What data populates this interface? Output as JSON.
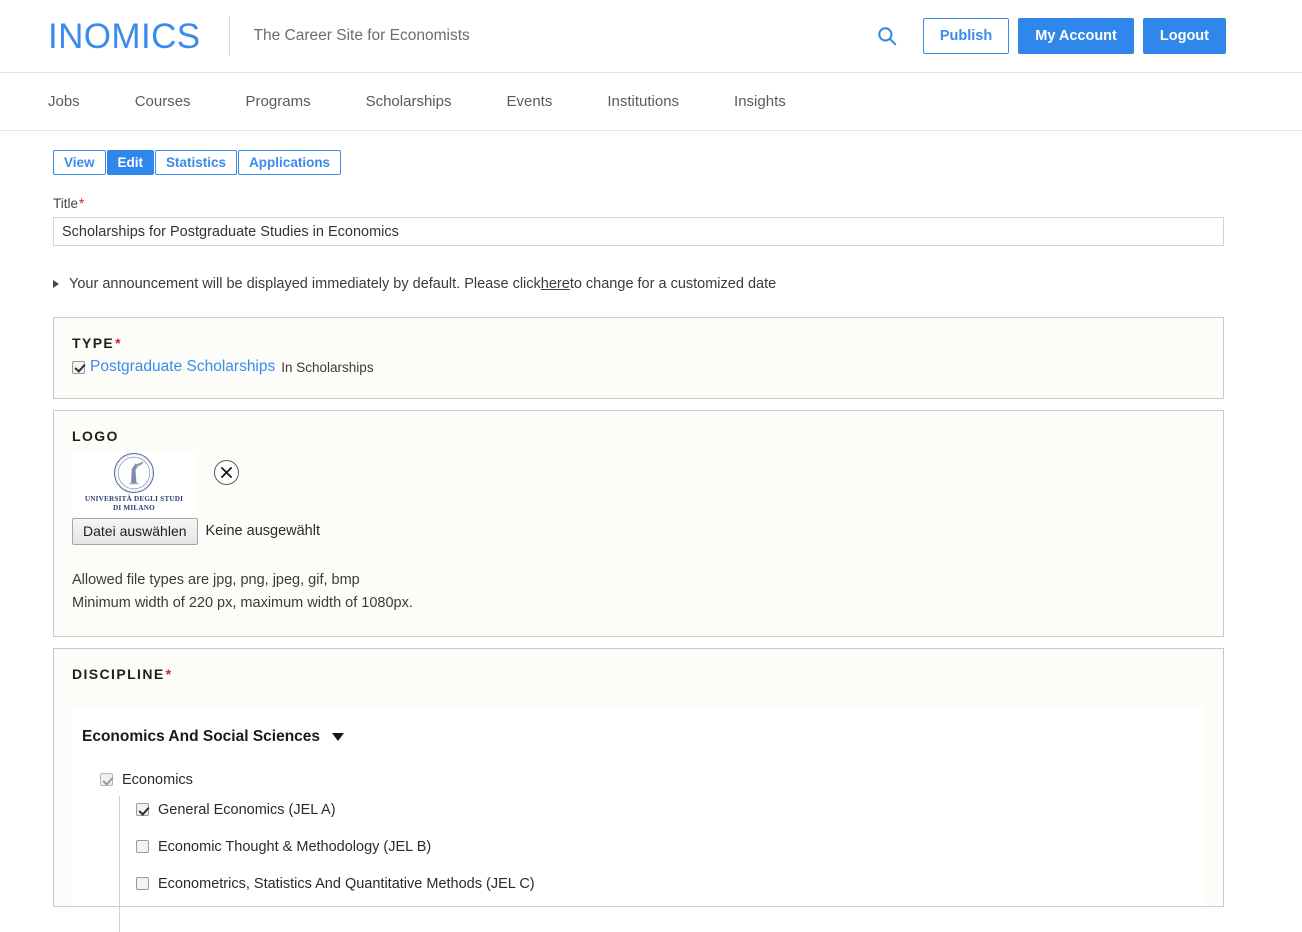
{
  "header": {
    "brand": "INOMICS",
    "tagline": "The Career Site for Economists",
    "search_icon": "search-icon",
    "publish_label": "Publish",
    "account_label": "My Account",
    "logout_label": "Logout",
    "brand_color": "#3b8beb",
    "primary_color": "#2f87ec"
  },
  "nav": {
    "items": [
      {
        "label": "Jobs"
      },
      {
        "label": "Courses"
      },
      {
        "label": "Programs"
      },
      {
        "label": "Scholarships"
      },
      {
        "label": "Events"
      },
      {
        "label": "Institutions"
      },
      {
        "label": "Insights"
      }
    ]
  },
  "tabs": [
    {
      "label": "View",
      "active": false
    },
    {
      "label": "Edit",
      "active": true
    },
    {
      "label": "Statistics",
      "active": false
    },
    {
      "label": "Applications",
      "active": false
    }
  ],
  "title_field": {
    "label": "Title",
    "required_marker": "*",
    "value": "Scholarships for Postgraduate Studies in Economics",
    "placeholder": ""
  },
  "announcement": {
    "text_before": "Your announcement will be displayed immediately by default. Please click ",
    "link": "here",
    "text_after": " to change for a customized date",
    "toggle_icon": "disclosure-triangle-icon"
  },
  "type_section": {
    "title": "TYPE",
    "required_marker": "*",
    "checkbox_checked": true,
    "link_label": "Postgraduate Scholarships",
    "suffix": "In Scholarships"
  },
  "logo_section": {
    "title": "LOGO",
    "image_alt": "UNIVERSITÀ DEGLI STUDI DI MILANO",
    "seal_line1": "UNIVERSITÀ DEGLI STUDI",
    "seal_line2": "DI MILANO",
    "remove_icon": "close-icon",
    "file_button": "Datei auswählen",
    "file_status": "Keine ausgewählt",
    "hint_line1": "Allowed file types are jpg, png, jpeg, gif, bmp",
    "hint_line2": "Minimum width of 220 px, maximum width of 1080px."
  },
  "discipline_section": {
    "title": "DISCIPLINE",
    "required_marker": "*",
    "group": {
      "label": "Economics And Social Sciences",
      "caret_icon": "chevron-down-icon",
      "expanded": true
    },
    "parent": {
      "label": "Economics",
      "checked": true,
      "disabled": true
    },
    "children": [
      {
        "label": "General Economics (JEL A)",
        "checked": true
      },
      {
        "label": "Economic Thought & Methodology (JEL B)",
        "checked": false
      },
      {
        "label": "Econometrics, Statistics And Quantitative Methods (JEL C)",
        "checked": false
      }
    ]
  }
}
